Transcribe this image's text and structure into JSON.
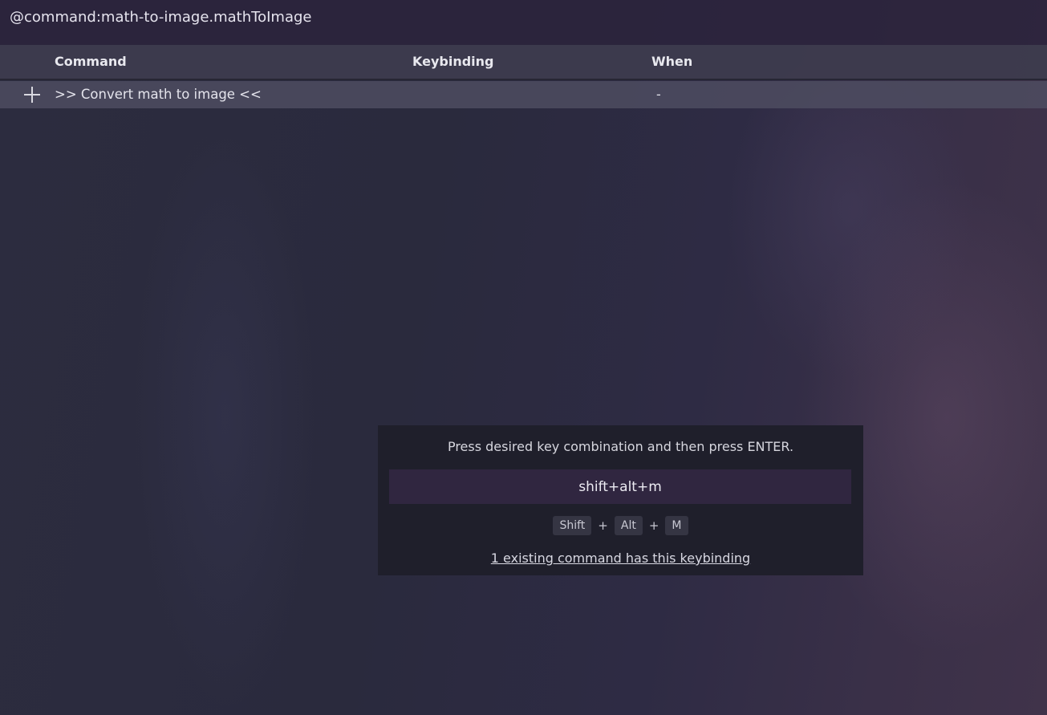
{
  "search": {
    "value": "@command:math-to-image.mathToImage"
  },
  "table": {
    "headers": {
      "command": "Command",
      "keybinding": "Keybinding",
      "when": "When"
    },
    "rows": [
      {
        "command": ">> Convert math to image <<",
        "keybinding": "",
        "when": "-"
      }
    ]
  },
  "dialog": {
    "message": "Press desired key combination and then press ENTER.",
    "input_value": "shift+alt+m",
    "keys": [
      "Shift",
      "Alt",
      "M"
    ],
    "separator": "+",
    "conflict_link": "1 existing command has this keybinding"
  }
}
